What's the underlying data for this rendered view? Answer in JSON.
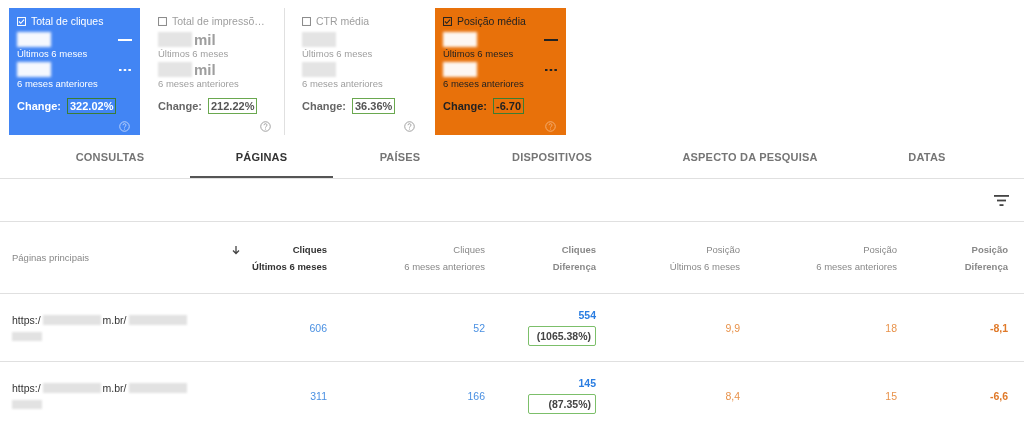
{
  "cards": [
    {
      "title": "Total de cliques",
      "checked": true,
      "color": "#4285f4",
      "current": {
        "label": "Últimos 6 meses"
      },
      "previous": {
        "label": "6 meses anteriores"
      },
      "change_label": "Change:",
      "change": "322.02%"
    },
    {
      "title": "Total de impressõ…",
      "checked": false,
      "current": {
        "unit": "mil",
        "label": "Últimos 6 meses"
      },
      "previous": {
        "unit": "mil",
        "label": "6 meses anteriores"
      },
      "change_label": "Change:",
      "change": "212.22%"
    },
    {
      "title": "CTR média",
      "checked": false,
      "current": {
        "label": "Últimos 6 meses"
      },
      "previous": {
        "label": "6 meses anteriores"
      },
      "change_label": "Change:",
      "change": "36.36%"
    },
    {
      "title": "Posição média",
      "checked": true,
      "color": "#e8710a",
      "current": {
        "label": "Últimos 6 meses"
      },
      "previous": {
        "label": "6 meses anteriores"
      },
      "change_label": "Change:",
      "change": "-6.70"
    }
  ],
  "tabs": [
    {
      "label": "CONSULTAS",
      "selected": false
    },
    {
      "label": "PÁGINAS",
      "selected": true
    },
    {
      "label": "PAÍSES",
      "selected": false
    },
    {
      "label": "DISPOSITIVOS",
      "selected": false
    },
    {
      "label": "ASPECTO DA PESQUISA",
      "selected": false
    },
    {
      "label": "DATAS",
      "selected": false
    }
  ],
  "table": {
    "columns": [
      {
        "title": "Páginas principais",
        "kind": "page",
        "sorted": false
      },
      {
        "title": "Cliques",
        "subtitle": "Últimos 6 meses",
        "kind": "clicks",
        "sorted": true
      },
      {
        "title": "Cliques",
        "subtitle": "6 meses anteriores",
        "kind": "clicks",
        "sorted": false
      },
      {
        "title": "Cliques",
        "subtitle": "Diferença",
        "kind": "clicks_diff",
        "sorted": false
      },
      {
        "title": "Posição",
        "subtitle": "Últimos 6 meses",
        "kind": "position",
        "sorted": false
      },
      {
        "title": "Posição",
        "subtitle": "6 meses anteriores",
        "kind": "position",
        "sorted": false
      },
      {
        "title": "Posição",
        "subtitle": "Diferença",
        "kind": "position_diff",
        "sorted": false
      }
    ],
    "rows": [
      {
        "cells": [
          {
            "url_parts": [
              "https:/",
              "m.br/"
            ]
          },
          {
            "value": "606"
          },
          {
            "value": "52"
          },
          {
            "value": "554",
            "percent": "(1065.38%)"
          },
          {
            "value": "9,9"
          },
          {
            "value": "18"
          },
          {
            "value": "-8,1"
          }
        ]
      },
      {
        "cells": [
          {
            "url_parts": [
              "https:/",
              "m.br/"
            ]
          },
          {
            "value": "311"
          },
          {
            "value": "166"
          },
          {
            "value": "145",
            "percent": "(87.35%)"
          },
          {
            "value": "8,4"
          },
          {
            "value": "15"
          },
          {
            "value": "-6,6"
          }
        ]
      }
    ]
  }
}
